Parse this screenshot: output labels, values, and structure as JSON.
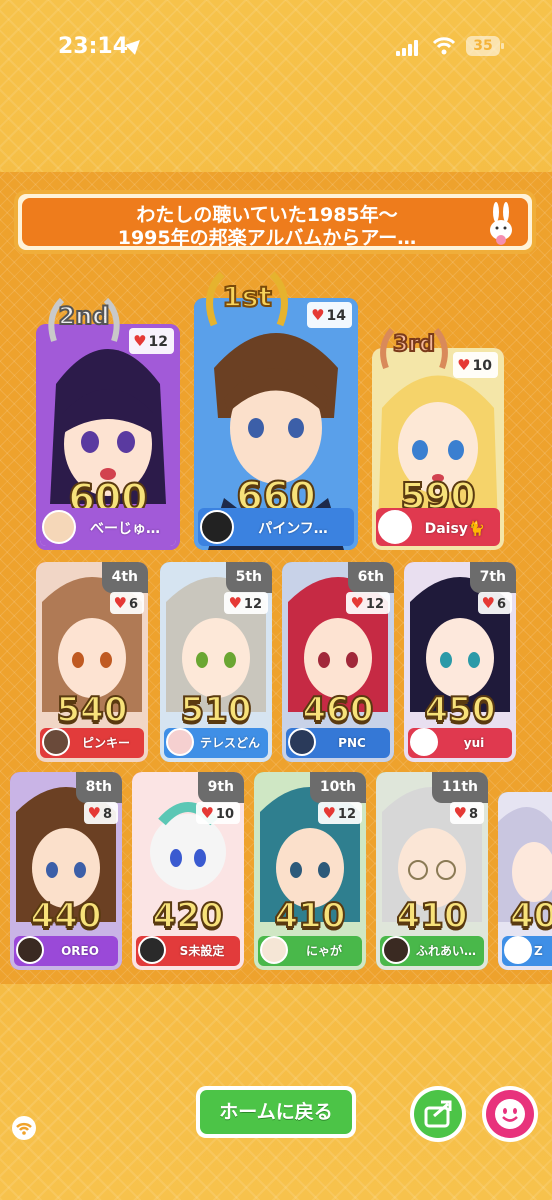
{
  "status_bar": {
    "time": "23:14",
    "battery": "35"
  },
  "title": "わたしの聴いていた1985年〜\n1995年の邦楽アルバムからアー…",
  "podium": [
    {
      "rank": "2nd",
      "likes": "12",
      "score": "600",
      "name": "べーじゅ…",
      "color": "#a25ad8"
    },
    {
      "rank": "1st",
      "likes": "14",
      "score": "660",
      "name": "パインフ…",
      "color": "#3b82e0"
    },
    {
      "rank": "3rd",
      "likes": "10",
      "score": "590",
      "name": "Daisy🐈",
      "color": "#e0394f"
    }
  ],
  "row2": [
    {
      "rank": "4th",
      "likes": "6",
      "score": "540",
      "name": "ピンキー",
      "color": "#e23b3b"
    },
    {
      "rank": "5th",
      "likes": "12",
      "score": "510",
      "name": "テレスどん",
      "color": "#3f8fe6"
    },
    {
      "rank": "6th",
      "likes": "12",
      "score": "460",
      "name": "PNC",
      "color": "#3578d6"
    },
    {
      "rank": "7th",
      "likes": "6",
      "score": "450",
      "name": "yui",
      "color": "#e0394f"
    }
  ],
  "row3": [
    {
      "rank": "8th",
      "likes": "8",
      "score": "440",
      "name": "OREO",
      "color": "#9a49d8"
    },
    {
      "rank": "9th",
      "likes": "10",
      "score": "420",
      "name": "S未設定",
      "color": "#e23b3b"
    },
    {
      "rank": "10th",
      "likes": "12",
      "score": "410",
      "name": "にゃが",
      "color": "#49b84a"
    },
    {
      "rank": "11th",
      "likes": "8",
      "score": "410",
      "name": "ふれあい…",
      "color": "#49b84a"
    },
    {
      "rank": "",
      "likes": "",
      "score": "40",
      "name": "Z",
      "color": "#3f8fe6"
    }
  ],
  "buttons": {
    "home": "ホームに戻る"
  },
  "icons": [
    "location-arrow-icon",
    "signal-icon",
    "wifi-icon",
    "battery-icon",
    "heart-icon",
    "share-icon",
    "smile-icon",
    "rabbit-icon",
    "laurel-icon"
  ]
}
